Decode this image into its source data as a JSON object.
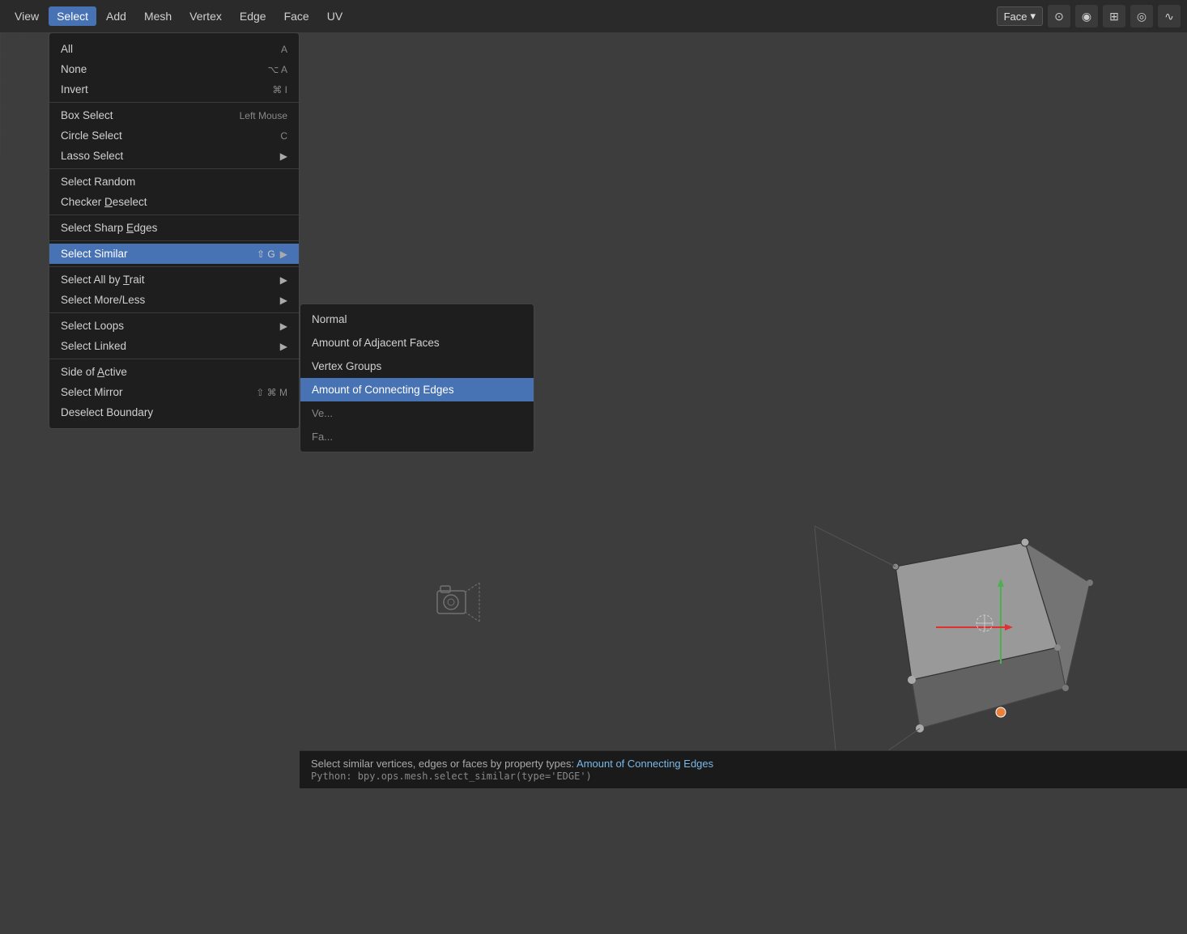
{
  "menubar": {
    "items": [
      {
        "id": "view",
        "label": "View",
        "active": false
      },
      {
        "id": "select",
        "label": "Select",
        "active": true
      },
      {
        "id": "add",
        "label": "Add",
        "active": false
      },
      {
        "id": "mesh",
        "label": "Mesh",
        "active": false
      },
      {
        "id": "vertex",
        "label": "Vertex",
        "active": false
      },
      {
        "id": "edge",
        "label": "Edge",
        "active": false
      },
      {
        "id": "face",
        "label": "Face",
        "active": false
      },
      {
        "id": "uv",
        "label": "UV",
        "active": false
      }
    ],
    "face_dropdown": "Face",
    "colors": {
      "active_bg": "#4772b3",
      "bar_bg": "#2a2a2a"
    }
  },
  "select_menu": {
    "sections": [
      {
        "items": [
          {
            "id": "all",
            "label": "All",
            "shortcut": "A",
            "has_arrow": false
          },
          {
            "id": "none",
            "label": "None",
            "shortcut": "⌥ A",
            "has_arrow": false
          },
          {
            "id": "invert",
            "label": "Invert",
            "shortcut": "⌘ I",
            "has_arrow": false
          }
        ]
      },
      {
        "items": [
          {
            "id": "box-select",
            "label": "Box Select",
            "shortcut": "Left Mouse",
            "has_arrow": false
          },
          {
            "id": "circle-select",
            "label": "Circle Select",
            "shortcut": "C",
            "has_arrow": false
          },
          {
            "id": "lasso-select",
            "label": "Lasso Select",
            "shortcut": "",
            "has_arrow": true
          }
        ]
      },
      {
        "items": [
          {
            "id": "select-random",
            "label": "Select Random",
            "shortcut": "",
            "has_arrow": false
          },
          {
            "id": "checker-deselect",
            "label": "Checker Deselect",
            "shortcut": "",
            "has_arrow": false
          }
        ]
      },
      {
        "items": [
          {
            "id": "select-sharp-edges",
            "label": "Select Sharp Edges",
            "shortcut": "",
            "has_arrow": false
          }
        ]
      },
      {
        "items": [
          {
            "id": "select-similar",
            "label": "Select Similar",
            "shortcut": "⇧ G",
            "has_arrow": true,
            "highlighted": true
          }
        ]
      },
      {
        "items": [
          {
            "id": "select-all-by-trait",
            "label": "Select All by Trait",
            "shortcut": "",
            "has_arrow": true
          },
          {
            "id": "select-more-less",
            "label": "Select More/Less",
            "shortcut": "",
            "has_arrow": true
          }
        ]
      },
      {
        "items": [
          {
            "id": "select-loops",
            "label": "Select Loops",
            "shortcut": "",
            "has_arrow": true
          },
          {
            "id": "select-linked",
            "label": "Select Linked",
            "shortcut": "",
            "has_arrow": true
          }
        ]
      },
      {
        "items": [
          {
            "id": "side-of-active",
            "label": "Side of Active",
            "shortcut": "",
            "has_arrow": false
          },
          {
            "id": "select-mirror",
            "label": "Select Mirror",
            "shortcut": "⇧ ⌘ M",
            "has_arrow": false
          },
          {
            "id": "deselect-boundary",
            "label": "Deselect Boundary",
            "shortcut": "",
            "has_arrow": false
          }
        ]
      }
    ]
  },
  "submenu": {
    "items": [
      {
        "id": "normal",
        "label": "Normal",
        "highlighted": false
      },
      {
        "id": "amount-adjacent-faces",
        "label": "Amount of Adjacent Faces",
        "highlighted": false
      },
      {
        "id": "vertex-groups",
        "label": "Vertex Groups",
        "highlighted": false
      },
      {
        "id": "amount-connecting-edges",
        "label": "Amount of Connecting Edges",
        "highlighted": true
      },
      {
        "id": "ve-partial",
        "label": "Ve...",
        "partial": true
      },
      {
        "id": "fa-partial",
        "label": "Fa...",
        "partial": true
      }
    ]
  },
  "tooltip": {
    "description": "Select similar vertices, edges or faces by property types:",
    "highlight_text": "Amount of Connecting Edges",
    "python_label": "Python:",
    "python_code": "bpy.ops.mesh.select_similar(type='EDGE')"
  },
  "viewport": {
    "background": "#3d3d3d"
  }
}
